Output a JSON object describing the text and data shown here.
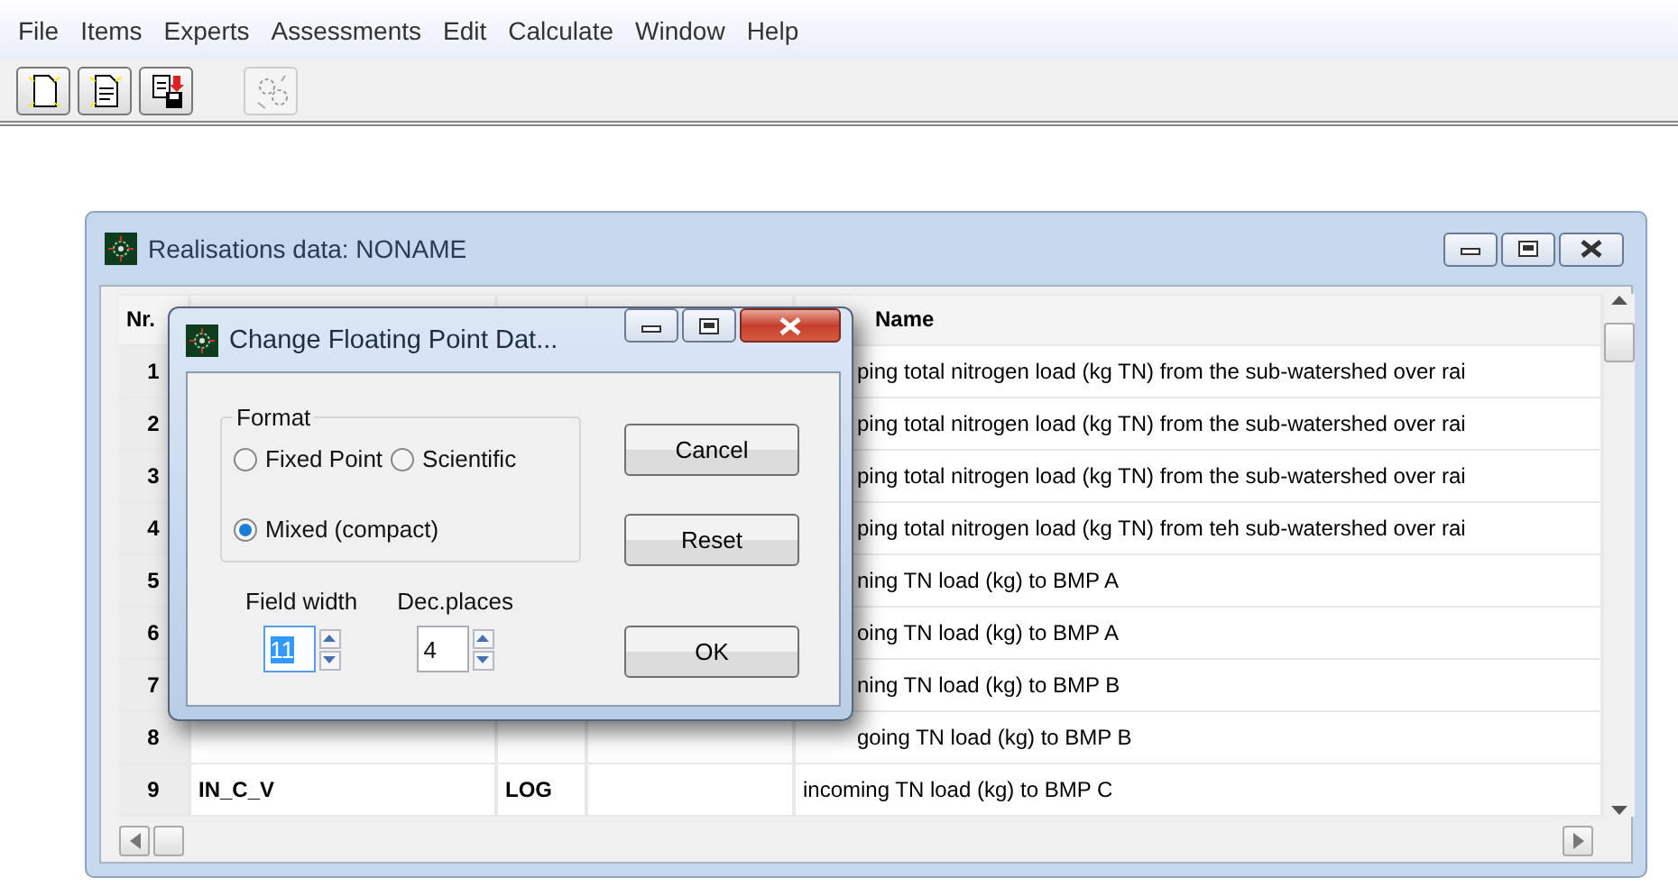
{
  "menu": [
    {
      "label": "File"
    },
    {
      "label": "Items"
    },
    {
      "label": "Experts"
    },
    {
      "label": "Assessments"
    },
    {
      "label": "Edit"
    },
    {
      "label": "Calculate"
    },
    {
      "label": "Window"
    },
    {
      "label": "Help"
    }
  ],
  "toolbar": [
    {
      "kind": "new",
      "disabled": false
    },
    {
      "kind": "open",
      "disabled": false
    },
    {
      "kind": "save",
      "disabled": false
    },
    {
      "kind": "gears",
      "disabled": true
    }
  ],
  "document_window": {
    "title": "Realisations data: NONAME",
    "table": {
      "header": {
        "column_1": "Nr.",
        "column_5": "Name"
      },
      "rows": [
        {
          "column_1": "1",
          "column_5": "ping total nitrogen load (kg TN) from the sub-watershed over rai"
        },
        {
          "column_1": "2",
          "column_5": "ping total nitrogen load (kg TN) from the sub-watershed over rai"
        },
        {
          "column_1": "3",
          "column_5": "ping total nitrogen load (kg TN) from the sub-watershed over rai"
        },
        {
          "column_1": "4",
          "column_5": "ping total nitrogen load (kg TN) from teh sub-watershed over rai"
        },
        {
          "column_1": "5",
          "column_5": "ning TN load (kg) to BMP A"
        },
        {
          "column_1": "6",
          "column_5": "oing TN load (kg) to BMP A"
        },
        {
          "column_1": "7",
          "column_5": "ning TN load (kg) to BMP B"
        },
        {
          "column_1": "8",
          "column_5": "going TN load (kg) to BMP B"
        },
        {
          "column_1": "9",
          "column_2": "IN_C_V",
          "column_3": "LOG",
          "column_5": "incoming TN load (kg) to BMP C"
        }
      ]
    }
  },
  "dialog": {
    "title": "Change Floating Point Dat...",
    "format": {
      "label": "Format",
      "options": [
        {
          "label": "Fixed Point",
          "selected": false
        },
        {
          "label": "Scientific",
          "selected": false
        },
        {
          "label": "Mixed (compact)",
          "selected": true
        }
      ]
    },
    "field_width": {
      "label": "Field width",
      "value": "11",
      "focused": true
    },
    "dec_places": {
      "label": "Dec.places",
      "value": "4",
      "focused": false
    },
    "buttons": [
      "Cancel",
      "Reset",
      "OK"
    ]
  }
}
